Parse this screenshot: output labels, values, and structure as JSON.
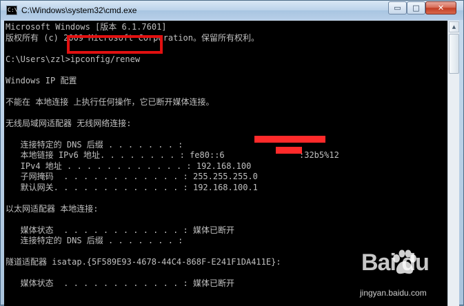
{
  "window": {
    "title": "C:\\Windows\\system32\\cmd.exe",
    "controls": {
      "minimize": "▭",
      "maximize": "□",
      "close": "✕"
    }
  },
  "console": {
    "lines": [
      "Microsoft Windows [版本 6.1.7601]",
      "版权所有 (c) 2009 Microsoft Corporation。保留所有权利。",
      "",
      "C:\\Users\\zzl>ipconfig/renew",
      "",
      "Windows IP 配置",
      "",
      "不能在 本地连接 上执行任何操作，它已断开媒体连接。",
      "",
      "无线局域网适配器 无线网络连接:",
      "",
      "   连接特定的 DNS 后缀 . . . . . . . :",
      "   本地链接 IPv6 地址. . . . . . . . : fe80::6               :32b5%12",
      "   IPv4 地址 . . . . . . . . . . . . : 192.168.100",
      "   子网掩码  . . . . . . . . . . . . : 255.255.255.0",
      "   默认网关. . . . . . . . . . . . . : 192.168.100.1",
      "",
      "以太网适配器 本地连接:",
      "",
      "   媒体状态  . . . . . . . . . . . . : 媒体已断开",
      "   连接特定的 DNS 后缀 . . . . . . . :",
      "",
      "隧道适配器 isatap.{5F589E93-4678-44C4-868F-E241F1DA411E}:",
      "",
      "   媒体状态  . . . . . . . . . . . . : 媒体已断开"
    ]
  },
  "watermark": {
    "logo": "Bai  du",
    "site": "jingyan.baidu.com"
  },
  "colors": {
    "console_bg": "#000000",
    "console_fg": "#c0c0c0",
    "highlight": "#e01010",
    "redaction": "#ff2a2a"
  }
}
